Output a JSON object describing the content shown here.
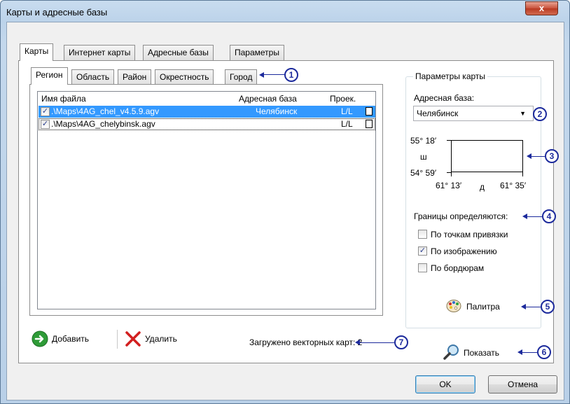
{
  "window": {
    "title": "Карты и адресные базы",
    "close_label": "x"
  },
  "main_tabs": [
    "Карты",
    "Интернет карты",
    "Адресные базы",
    "Параметры"
  ],
  "sub_tabs": [
    "Регион",
    "Область",
    "Район",
    "Окрестность",
    "Город"
  ],
  "file_list": {
    "columns": [
      "Имя файла",
      "Адресная база",
      "Проек."
    ],
    "rows": [
      {
        "checked": true,
        "file": ".\\Maps\\4AG_chel_v4.5.9.agv",
        "base": "Челябинск",
        "proj": "L/L",
        "selected": true
      },
      {
        "checked": true,
        "file": ".\\Maps\\4AG_chelybinsk.agv",
        "base": "",
        "proj": "L/L",
        "selected": false
      }
    ]
  },
  "toolbar": {
    "add_label": "Добавить",
    "delete_label": "Удалить",
    "status": "Загружено векторных карт: 2"
  },
  "map_params": {
    "group_title": "Параметры карты",
    "address_base_label": "Адресная база:",
    "address_base_value": "Челябинск",
    "lat_top": "55° 18′",
    "lat_bottom": "54° 59′",
    "lat_letter": "ш",
    "lon_left": "61° 13′",
    "lon_right": "61° 35′",
    "lon_letter": "д",
    "bounds_label": "Границы определяются:",
    "options": [
      {
        "label": "По точкам привязки",
        "checked": false
      },
      {
        "label": "По изображению",
        "checked": true
      },
      {
        "label": "По бордюрам",
        "checked": false
      }
    ],
    "palette_label": "Палитра",
    "show_label": "Показать"
  },
  "dialog_buttons": {
    "ok": "OK",
    "cancel": "Отмена"
  },
  "callouts": [
    "1",
    "2",
    "3",
    "4",
    "5",
    "6",
    "7"
  ],
  "colors": {
    "selection": "#3399ff",
    "callout": "#1c2a9c",
    "delete": "#d21f1f",
    "add": "#2e9b37"
  }
}
